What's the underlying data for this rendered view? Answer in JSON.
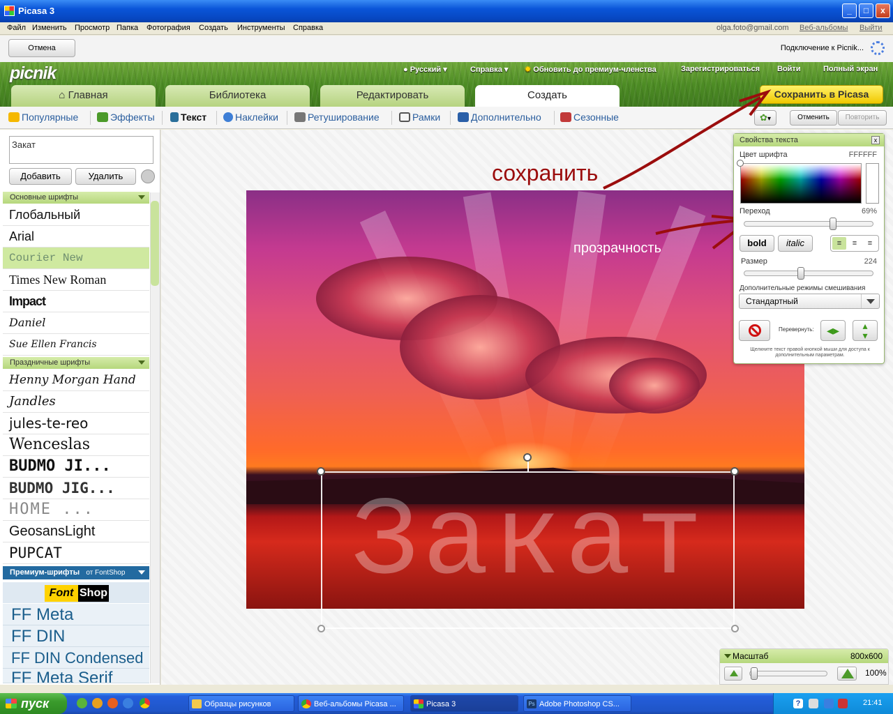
{
  "window": {
    "title": "Picasa 3",
    "min": "_",
    "max": "□",
    "close": "x"
  },
  "menu": {
    "items": [
      "Файл",
      "Изменить",
      "Просмотр",
      "Папка",
      "Фотография",
      "Создать",
      "Инструменты",
      "Справка"
    ],
    "account": "olga.foto@gmail.com",
    "web_albums": "Веб-альбомы",
    "logout": "Выйти"
  },
  "toolbar": {
    "cancel": "Отмена",
    "connecting": "Подключение к Picnik..."
  },
  "picnik": {
    "logo": "picnik",
    "header_links": [
      "Русский",
      "Справка",
      "Обновить до премиум-членства",
      "Зарегистрироваться",
      "Войти",
      "Полный экран"
    ],
    "tabs": [
      "Главная",
      "Библиотека",
      "Редактировать",
      "Создать"
    ],
    "active_tab": "Создать",
    "save_to_picasa": "Сохранить в Picasa"
  },
  "subnav": {
    "items": [
      "Популярные",
      "Эффекты",
      "Текст",
      "Наклейки",
      "Ретуширование",
      "Рамки",
      "Дополнительно",
      "Сезонные"
    ],
    "active": "Текст",
    "undo": "Отменить",
    "redo": "Повторить"
  },
  "leftpanel": {
    "text_value": "Закат",
    "add": "Добавить",
    "remove": "Удалить",
    "basic_header": "Основные шрифты",
    "basic_fonts": [
      "Глобальный",
      "Arial",
      "Courier New",
      "Times New Roman",
      "Impact",
      "Daniel",
      "Sue Ellen Francis"
    ],
    "selected_font": "Courier New",
    "holiday_header": "Праздничные шрифты",
    "holiday_fonts": [
      "Henny Morgan Hand",
      "Jandles",
      "jules-te-reo",
      "Wenceslas",
      "BUDMO JI...",
      "BUDMO JIG...",
      "HOME ...",
      "GeosansLight",
      "PUPCAT"
    ],
    "premium_header": "Премиум-шрифты",
    "premium_from": "от FontShop",
    "fontshop_a": "Font",
    "fontshop_b": "Shop",
    "premium_fonts": [
      "FF Meta",
      "FF DIN",
      "FF DIN Condensed",
      "FF Meta Serif"
    ]
  },
  "canvas": {
    "overlay_text": "Закат",
    "annotation_save": "сохранить",
    "annotation_transparency": "прозрачность"
  },
  "props": {
    "title": "Свойства текста",
    "close": "x",
    "font_color_label": "Цвет шрифта",
    "font_color_value": "FFFFFF",
    "fade_label": "Переход",
    "fade_value": "69%",
    "fade_fraction": 0.69,
    "bold": "bold",
    "italic": "italic",
    "size_label": "Размер",
    "size_value": "224",
    "blend_label": "Дополнительные режимы смешивания",
    "blend_value": "Стандартный",
    "flip_label": "Перевернуть:",
    "hint": "Щелкните текст правой кнопкой мыши для доступа к дополнительным параметрам."
  },
  "zoom": {
    "label": "Масштаб",
    "dimensions": "800x600",
    "percent": "100%"
  },
  "taskbar": {
    "start": "пуск",
    "tasks": [
      "Образцы рисунков",
      "Веб-альбомы Picasa ...",
      "Picasa 3",
      "Adobe Photoshop CS..."
    ],
    "active_task": "Picasa 3",
    "lang": "RU",
    "time": "21:41"
  },
  "colors": {
    "xp_blue": "#0a55d8",
    "picnik_green": "#4d8c24",
    "save_yellow": "#f0c800",
    "annotation_red": "#9b0d0d"
  }
}
